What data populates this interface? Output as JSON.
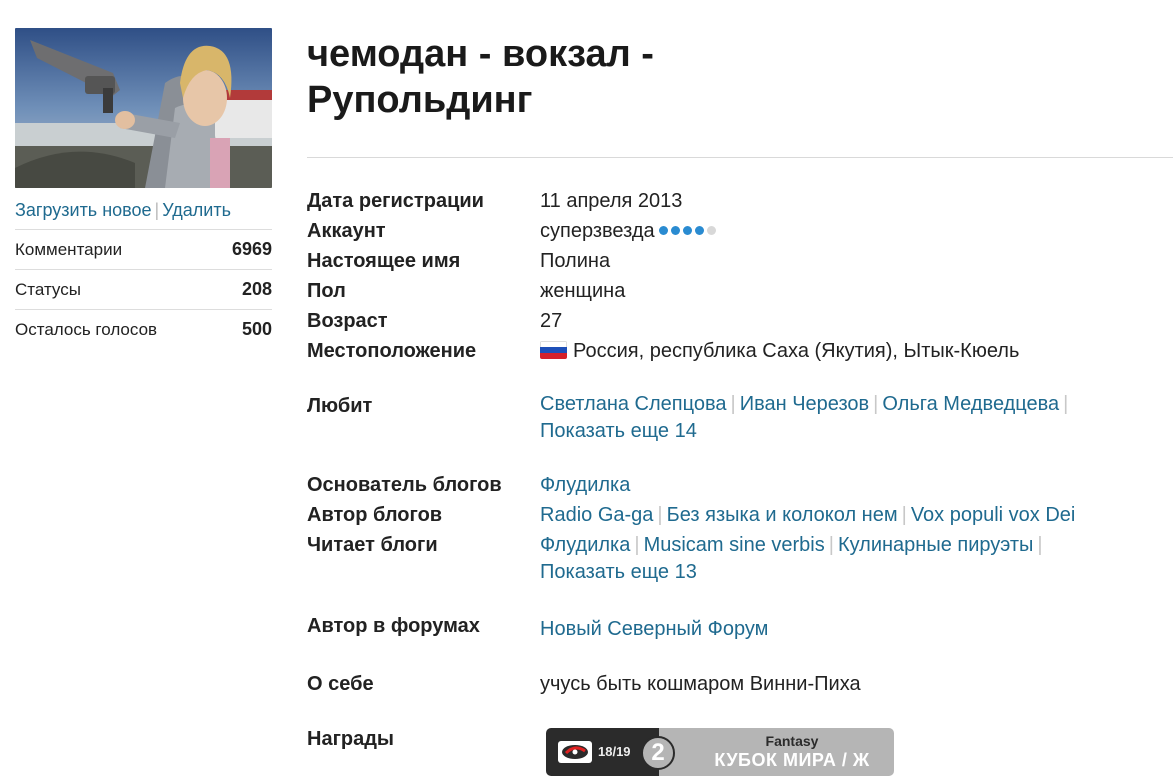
{
  "profile": {
    "title": "чемодан - вокзал - Рупольдинг",
    "avatar_upload": "Загрузить новое",
    "avatar_delete": "Удалить"
  },
  "stats": [
    {
      "label": "Комментарии",
      "value": "6969"
    },
    {
      "label": "Статусы",
      "value": "208"
    },
    {
      "label": "Осталось голосов",
      "value": "500"
    }
  ],
  "fields": {
    "reg_label": "Дата регистрации",
    "reg_value": "11 апреля 2013",
    "account_label": "Аккаунт",
    "account_value": "суперзвезда",
    "account_level": 4,
    "account_level_max": 5,
    "realname_label": "Настоящее имя",
    "realname_value": "Полина",
    "gender_label": "Пол",
    "gender_value": "женщина",
    "age_label": "Возраст",
    "age_value": "27",
    "location_label": "Местоположение",
    "location_value": "Россия, республика Саха (Якутия), Ытык-Кюель",
    "likes_label": "Любит",
    "likes": [
      "Светлана Слепцова",
      "Иван Черезов",
      "Ольга Медведцева"
    ],
    "likes_more": "Показать еще 14",
    "founder_label": "Основатель блогов",
    "founder": [
      "Флудилка"
    ],
    "author_label": "Автор блогов",
    "author": [
      "Radio Ga-ga",
      "Без языка и колокол нем",
      "Vox populi vox Dei"
    ],
    "reads_label": "Читает блоги",
    "reads": [
      "Флудилка",
      "Musicam sine verbis",
      "Кулинарные пируэты"
    ],
    "reads_more": "Показать еще 13",
    "forums_label": "Автор в форумах",
    "forums": [
      "Новый Северный Форум"
    ],
    "about_label": "О себе",
    "about_value": "учусь быть кошмаром Винни-Пиха",
    "awards_label": "Награды"
  },
  "award": {
    "season": "18/19",
    "number": "2",
    "top": "Fantasy",
    "bottom": "КУБОК МИРА / Ж"
  },
  "colors": {
    "link": "#1f6a8f",
    "level_dot": "#2a8bd1",
    "level_dot_off": "#d8d8d8"
  }
}
